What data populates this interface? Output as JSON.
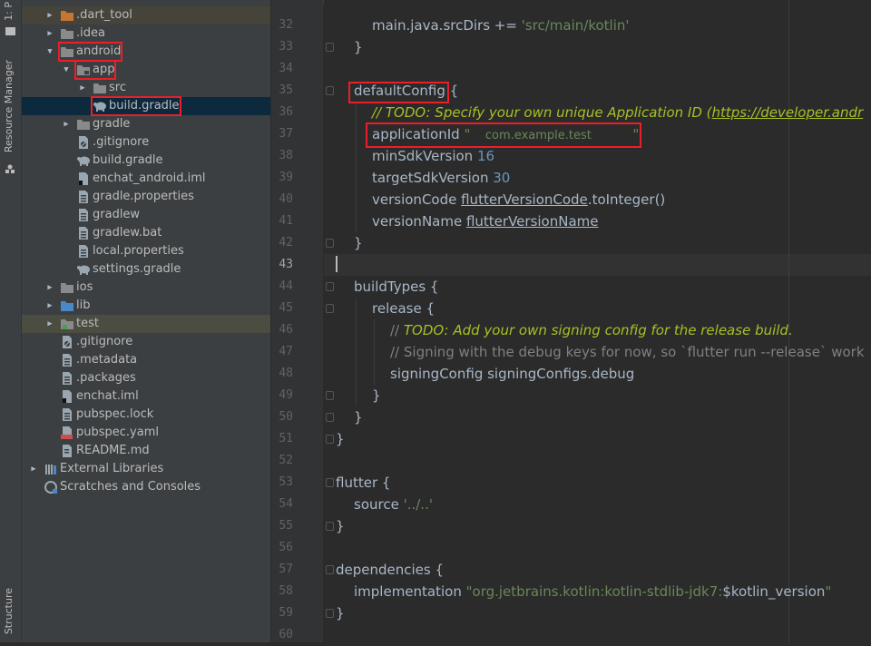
{
  "toolwindow_strip": {
    "project_tab": "1: P",
    "resource_manager_tab": "Resource Manager",
    "structure_tab": "Structure"
  },
  "project_tree": [
    {
      "label": ".dart_tool",
      "indent": 1,
      "arrow": "right",
      "icon": "folder-orange-icon",
      "style": "excluded"
    },
    {
      "label": ".idea",
      "indent": 1,
      "arrow": "right",
      "icon": "folder-idea-icon"
    },
    {
      "label": "android",
      "indent": 1,
      "arrow": "down",
      "icon": "folder-android-icon",
      "highlight": true
    },
    {
      "label": "app",
      "indent": 2,
      "arrow": "down",
      "icon": "folder-module-icon",
      "highlight": true
    },
    {
      "label": "src",
      "indent": 3,
      "arrow": "right",
      "icon": "folder-icon"
    },
    {
      "label": "build.gradle",
      "indent": 3,
      "icon": "gradle-elephant-icon",
      "selected": true,
      "highlight": true
    },
    {
      "label": "gradle",
      "indent": 2,
      "arrow": "right",
      "icon": "folder-icon"
    },
    {
      "label": ".gitignore",
      "indent": 2,
      "icon": "gitignore-file-icon"
    },
    {
      "label": "build.gradle",
      "indent": 2,
      "icon": "gradle-elephant-icon"
    },
    {
      "label": "enchat_android.iml",
      "indent": 2,
      "icon": "iml-file-icon"
    },
    {
      "label": "gradle.properties",
      "indent": 2,
      "icon": "properties-file-icon"
    },
    {
      "label": "gradlew",
      "indent": 2,
      "icon": "text-file-icon"
    },
    {
      "label": "gradlew.bat",
      "indent": 2,
      "icon": "text-file-icon"
    },
    {
      "label": "local.properties",
      "indent": 2,
      "icon": "properties-file-icon"
    },
    {
      "label": "settings.gradle",
      "indent": 2,
      "icon": "gradle-elephant-icon"
    },
    {
      "label": "ios",
      "indent": 1,
      "arrow": "right",
      "icon": "folder-icon"
    },
    {
      "label": "lib",
      "indent": 1,
      "arrow": "right",
      "icon": "folder-source-icon"
    },
    {
      "label": "test",
      "indent": 1,
      "arrow": "right",
      "icon": "folder-test-icon",
      "style": "testrow"
    },
    {
      "label": ".gitignore",
      "indent": 1,
      "icon": "gitignore-file-icon"
    },
    {
      "label": ".metadata",
      "indent": 1,
      "icon": "text-file-icon"
    },
    {
      "label": ".packages",
      "indent": 1,
      "icon": "text-file-icon"
    },
    {
      "label": "enchat.iml",
      "indent": 1,
      "icon": "iml-file-icon"
    },
    {
      "label": "pubspec.lock",
      "indent": 1,
      "icon": "text-file-icon"
    },
    {
      "label": "pubspec.yaml",
      "indent": 1,
      "icon": "yaml-file-icon"
    },
    {
      "label": "README.md",
      "indent": 1,
      "icon": "markdown-file-icon"
    },
    {
      "label": "External Libraries",
      "indent": 0,
      "arrow": "right",
      "icon": "libraries-icon"
    },
    {
      "label": "Scratches and Consoles",
      "indent": 0,
      "icon": "scratches-icon"
    }
  ],
  "editor": {
    "current_line": 43,
    "lines": [
      {
        "n": 32,
        "indent": 2,
        "parts": [
          [
            "main.java.srcDirs += ",
            ""
          ],
          [
            "'src/main/kotlin'",
            "str"
          ]
        ]
      },
      {
        "n": 33,
        "indent": 1,
        "parts": [
          [
            "}",
            ""
          ]
        ]
      },
      {
        "n": 34,
        "indent": 0,
        "parts": []
      },
      {
        "n": 35,
        "indent": 1,
        "parts": [
          [
            "defaultConfig",
            "hl"
          ],
          [
            " {",
            ""
          ]
        ]
      },
      {
        "n": 36,
        "indent": 2,
        "parts": [
          [
            "// TODO: Specify your own unique Application ID (",
            "todo"
          ],
          [
            "https://developer.andr",
            "todo u"
          ]
        ]
      },
      {
        "n": 37,
        "indent": 2,
        "parts": [
          [
            "applicationId ",
            ""
          ],
          [
            "\"",
            "str"
          ],
          [
            "    com.example.test           ",
            "masked"
          ],
          [
            "\"",
            "str"
          ]
        ]
      },
      {
        "n": 38,
        "indent": 2,
        "parts": [
          [
            "minSdkVersion ",
            ""
          ],
          [
            "16",
            "num"
          ]
        ]
      },
      {
        "n": 39,
        "indent": 2,
        "parts": [
          [
            "targetSdkVersion ",
            ""
          ],
          [
            "30",
            "num"
          ]
        ]
      },
      {
        "n": 40,
        "indent": 2,
        "parts": [
          [
            "versionCode ",
            ""
          ],
          [
            "flutterVersionCode",
            "u"
          ],
          [
            ".toInteger()",
            ""
          ]
        ]
      },
      {
        "n": 41,
        "indent": 2,
        "parts": [
          [
            "versionName ",
            ""
          ],
          [
            "flutterVersionName",
            "u"
          ]
        ]
      },
      {
        "n": 42,
        "indent": 1,
        "parts": [
          [
            "}",
            ""
          ]
        ]
      },
      {
        "n": 43,
        "indent": 0,
        "parts": []
      },
      {
        "n": 44,
        "indent": 1,
        "parts": [
          [
            "buildTypes {",
            ""
          ]
        ]
      },
      {
        "n": 45,
        "indent": 2,
        "parts": [
          [
            "release {",
            ""
          ]
        ]
      },
      {
        "n": 46,
        "indent": 3,
        "parts": [
          [
            "// ",
            "cmt"
          ],
          [
            "TODO: Add your own signing config for the release build.",
            "todo"
          ]
        ]
      },
      {
        "n": 47,
        "indent": 3,
        "parts": [
          [
            "// Signing with the debug keys for now, so `flutter run --release` work",
            "cmt"
          ]
        ]
      },
      {
        "n": 48,
        "indent": 3,
        "parts": [
          [
            "signingConfig signingConfigs.debug",
            ""
          ]
        ]
      },
      {
        "n": 49,
        "indent": 2,
        "parts": [
          [
            "}",
            ""
          ]
        ]
      },
      {
        "n": 50,
        "indent": 1,
        "parts": [
          [
            "}",
            ""
          ]
        ]
      },
      {
        "n": 51,
        "indent": 0,
        "parts": [
          [
            "}",
            ""
          ]
        ]
      },
      {
        "n": 52,
        "indent": 0,
        "parts": []
      },
      {
        "n": 53,
        "indent": 0,
        "parts": [
          [
            "flutter {",
            ""
          ]
        ]
      },
      {
        "n": 54,
        "indent": 1,
        "parts": [
          [
            "source ",
            ""
          ],
          [
            "'../..'",
            "str"
          ]
        ]
      },
      {
        "n": 55,
        "indent": 0,
        "parts": [
          [
            "}",
            ""
          ]
        ]
      },
      {
        "n": 56,
        "indent": 0,
        "parts": []
      },
      {
        "n": 57,
        "indent": 0,
        "parts": [
          [
            "dependencies {",
            ""
          ]
        ]
      },
      {
        "n": 58,
        "indent": 1,
        "parts": [
          [
            "implementation ",
            ""
          ],
          [
            "\"org.jetbrains.kotlin:kotlin-stdlib-jdk7:",
            "str"
          ],
          [
            "$kotlin_version",
            ""
          ],
          [
            "\"",
            "str"
          ]
        ]
      },
      {
        "n": 59,
        "indent": 0,
        "parts": [
          [
            "}",
            ""
          ]
        ]
      },
      {
        "n": 60,
        "indent": 0,
        "parts": []
      }
    ]
  },
  "colors": {
    "highlight_box": "#e8202a",
    "string": "#6a8759",
    "number": "#6897bb",
    "todo": "#a8c023",
    "selection": "#0d293e"
  }
}
